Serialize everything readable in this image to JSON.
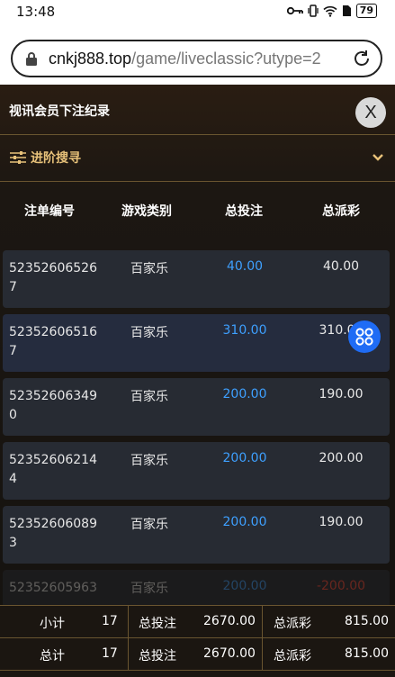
{
  "status_bar": {
    "time": "13:48",
    "battery": "79"
  },
  "browser": {
    "url_host": "cnkj888.top",
    "url_path": "/game/liveclassic?utype=2"
  },
  "modal": {
    "title": "视讯会员下注纪录",
    "close_label": "X"
  },
  "advanced_search": {
    "label": "进阶搜寻"
  },
  "table": {
    "headers": [
      "注单编号",
      "游戏类别",
      "总投注",
      "总派彩"
    ],
    "rows": [
      {
        "id": "523526065267",
        "game": "百家乐",
        "bet": "40.00",
        "payout": "40.00"
      },
      {
        "id": "523526065167",
        "game": "百家乐",
        "bet": "310.00",
        "payout": "310.00"
      },
      {
        "id": "523526063490",
        "game": "百家乐",
        "bet": "200.00",
        "payout": "190.00"
      },
      {
        "id": "523526062144",
        "game": "百家乐",
        "bet": "200.00",
        "payout": "200.00"
      },
      {
        "id": "523526060893",
        "game": "百家乐",
        "bet": "200.00",
        "payout": "190.00"
      },
      {
        "id": "52352605963",
        "game": "百家乐",
        "bet": "200.00",
        "payout": "-200.00"
      }
    ]
  },
  "summary": {
    "subtotal": {
      "label": "小计",
      "count": "17",
      "bet_label": "总投注",
      "bet": "2670.00",
      "payout_label": "总派彩",
      "payout": "815.00"
    },
    "total": {
      "label": "总计",
      "count": "17",
      "bet_label": "总投注",
      "bet": "2670.00",
      "payout_label": "总派彩",
      "payout": "815.00"
    }
  },
  "colors": {
    "accent_gold": "#e8c27a",
    "bet_blue": "#3ea0ff",
    "negative_red": "#ff4a3a",
    "float_button": "#1f6cf5"
  }
}
